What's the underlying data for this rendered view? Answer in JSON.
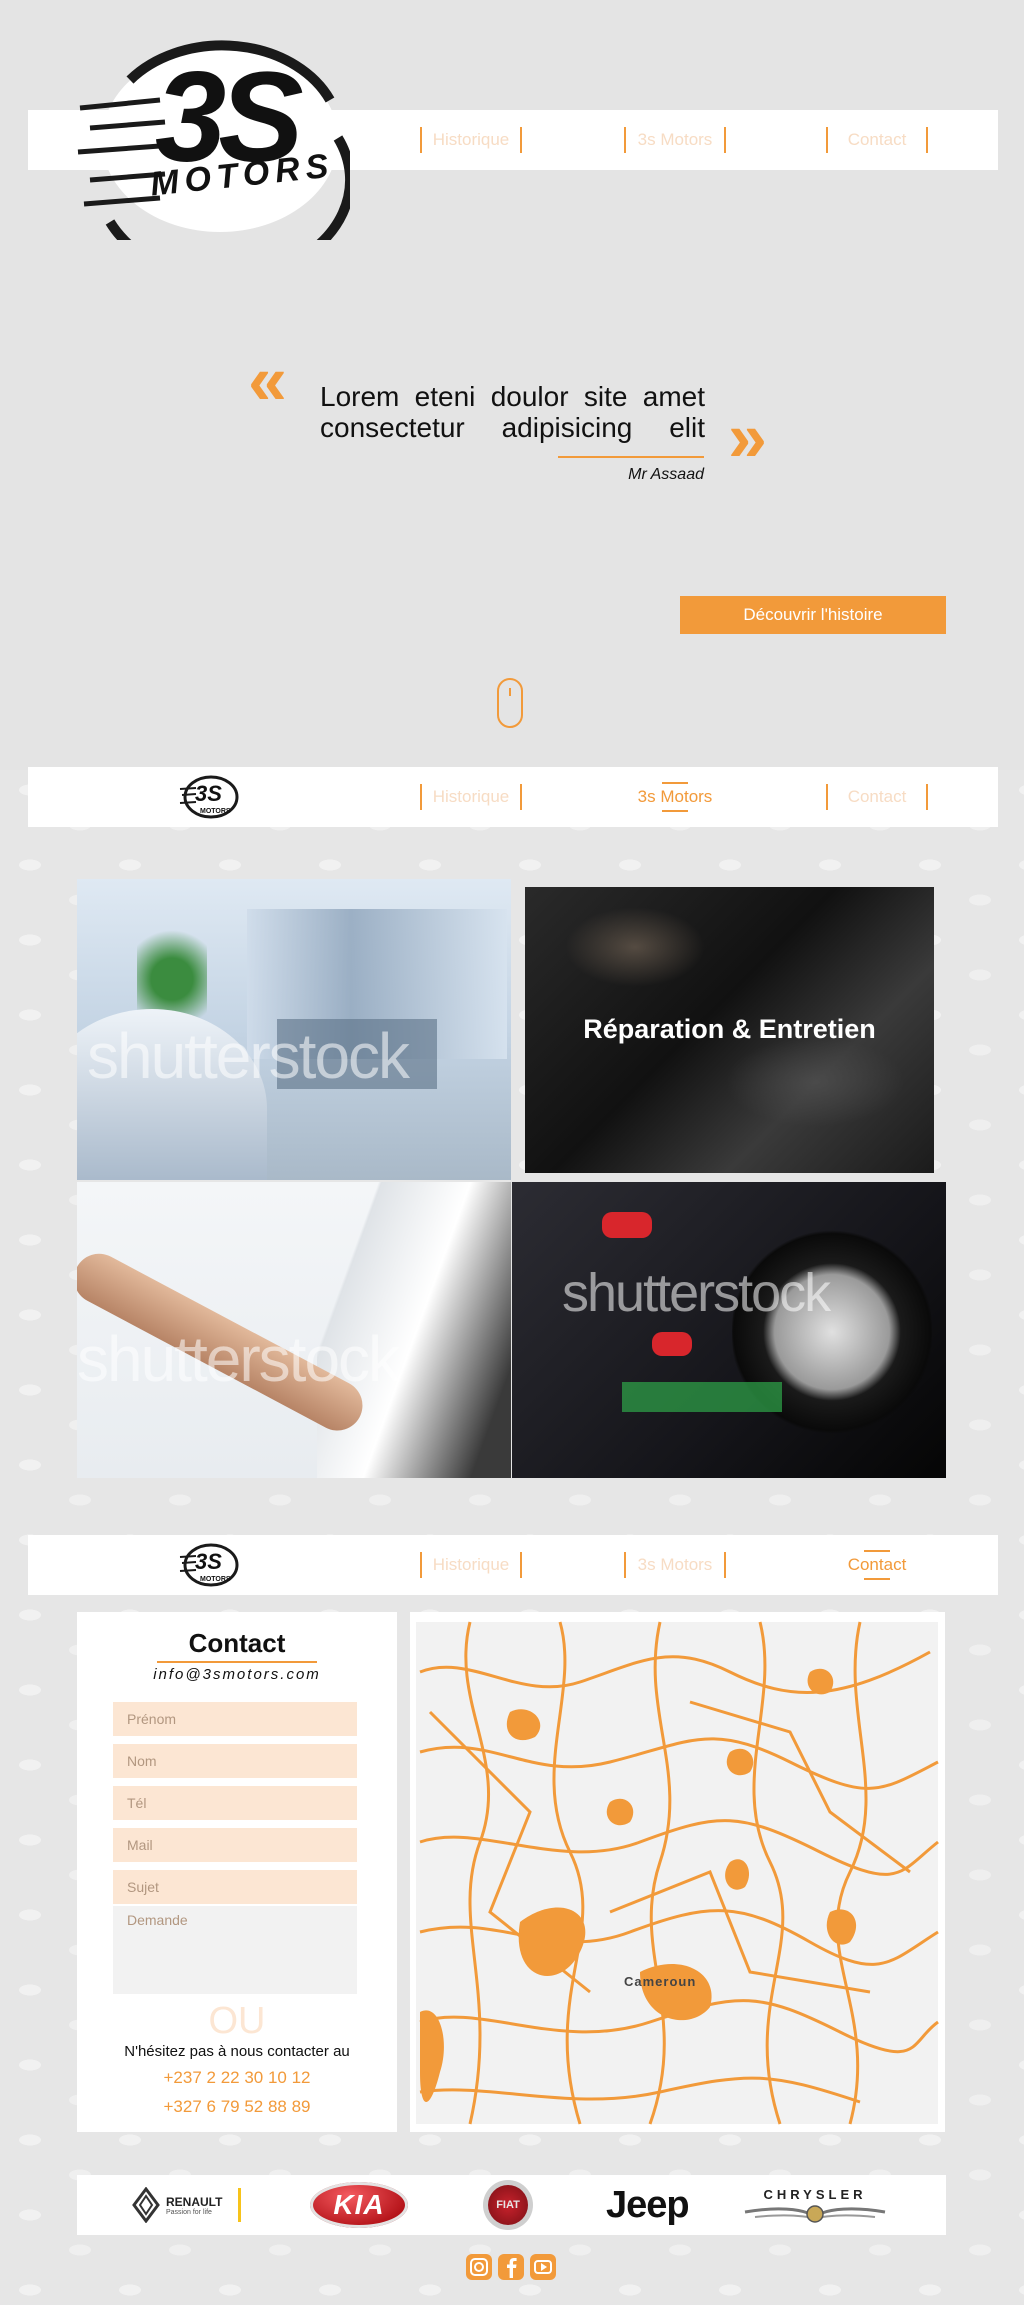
{
  "brand": {
    "logo_number": "3S",
    "logo_word": "MOTORS"
  },
  "nav": {
    "historique": "Historique",
    "motors": "3s Motors",
    "contact": "Contact"
  },
  "hero": {
    "quote_line1": "Lorem eteni doulor site amet",
    "quote_line2": "consectetur  adipisicing  elit",
    "author": "Mr Assaad",
    "cta": "Découvrir l'histoire",
    "open_quote": "«",
    "close_quote": "»"
  },
  "services": {
    "repair_title": "Réparation & Entretien",
    "watermark": "shutterstock"
  },
  "contact": {
    "title": "Contact",
    "email": "info@3smotors.com",
    "fields": {
      "prenom": "Prénom",
      "nom": "Nom",
      "tel": "Tél",
      "mail": "Mail",
      "sujet": "Sujet",
      "demande": "Demande"
    },
    "or_text": "OU",
    "prompt": "N'hésitez pas à nous contacter au",
    "phone1": "+237 2 22 30 10 12",
    "phone2": "+327 6 79 52 88 89"
  },
  "map": {
    "label": "Cameroun"
  },
  "partners": {
    "renault": "RENAULT",
    "renault_tag": "Passion for life",
    "kia": "KIA",
    "fiat": "FIAT",
    "jeep": "Jeep",
    "chrysler": "CHRYSLER"
  },
  "colors": {
    "accent": "#f29a3a",
    "background": "#e4e4e4"
  },
  "icons": [
    "instagram-icon",
    "facebook-icon",
    "youtube-icon",
    "mouse-scroll-icon"
  ]
}
